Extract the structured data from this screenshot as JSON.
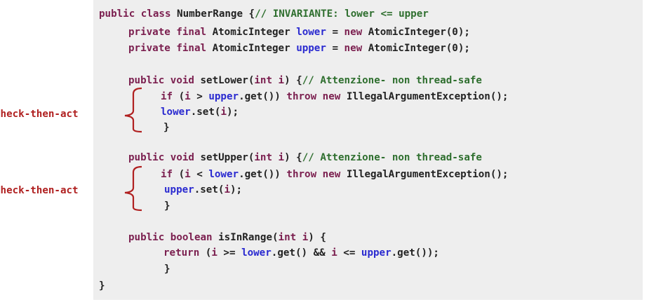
{
  "colors": {
    "background": "#eeeeee",
    "keyword": "#7b1f4f",
    "field": "#2a2ad0",
    "comment": "#2f6f2f",
    "plain": "#222222",
    "annotation": "#b02020"
  },
  "annotations": {
    "label1": "check-then-act",
    "label2": "check-then-act"
  },
  "code": {
    "l1": {
      "kw": "public class ",
      "name": "NumberRange {",
      "comment": "// INVARIANTE: lower <= upper"
    },
    "l2": {
      "kw": "private final ",
      "type": "AtomicInteger ",
      "field": "lower",
      "eq": " = ",
      "newkw": "new ",
      "ctor": "AtomicInteger(0);"
    },
    "l3": {
      "kw": "private final ",
      "type": "AtomicInteger ",
      "field": "upper",
      "eq": " = ",
      "newkw": "new ",
      "ctor": "AtomicInteger(0);"
    },
    "l4": {
      "kw": "public void ",
      "name": "setLower(",
      "intkw": "int ",
      "param": "i",
      "rest": ") {",
      "comment": "// Attenzione- non thread-safe"
    },
    "l5": {
      "ifkw": "if ",
      "p1": "(",
      "param": "i",
      "op": " > ",
      "field": "upper",
      "call": ".get()) ",
      "throwkw": "throw new ",
      "exc": "IllegalArgumentException();"
    },
    "l6": {
      "field": "lower",
      "call": ".set(",
      "param": "i",
      "end": ");"
    },
    "l7": {
      "brace": "}"
    },
    "l8": {
      "kw": "public void ",
      "name": "setUpper(",
      "intkw": "int ",
      "param": "i",
      "rest": ") {",
      "comment": "// Attenzione- non thread-safe"
    },
    "l9": {
      "ifkw": "if ",
      "p1": "(",
      "param": "i",
      "op": " < ",
      "field": "lower",
      "call": ".get()) ",
      "throwkw": "throw new ",
      "exc": "IllegalArgumentException();"
    },
    "l10": {
      "field": "upper",
      "call": ".set(",
      "param": "i",
      "end": ");"
    },
    "l11": {
      "brace": "}"
    },
    "l12": {
      "kw": "public boolean ",
      "name": "isInRange(",
      "intkw": "int ",
      "param": "i",
      "rest": ") {"
    },
    "l13": {
      "retkw": "return ",
      "p1": "(",
      "param": "i",
      "op1": " >= ",
      "field1": "lower",
      "call1": ".get() && ",
      "param2": "i",
      "op2": " <= ",
      "field2": "upper",
      "call2": ".get());"
    },
    "l14": {
      "brace": "}"
    },
    "l15": {
      "brace": "}"
    }
  }
}
